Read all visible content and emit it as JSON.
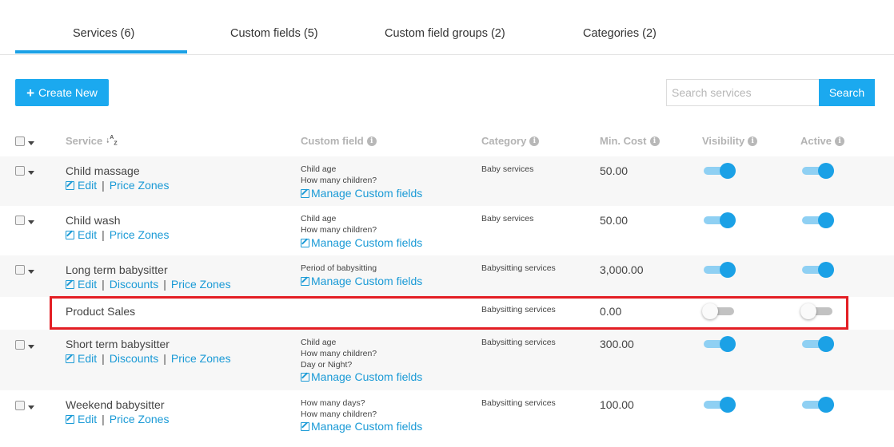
{
  "tabs": [
    {
      "label": "Services (6)"
    },
    {
      "label": "Custom fields (5)"
    },
    {
      "label": "Custom field groups (2)"
    },
    {
      "label": "Categories (2)"
    }
  ],
  "toolbar": {
    "create_label": "Create New",
    "search_placeholder": "Search services",
    "search_label": "Search"
  },
  "columns": {
    "service": "Service",
    "custom_field": "Custom field",
    "category": "Category",
    "min_cost": "Min. Cost",
    "visibility": "Visibility",
    "active": "Active"
  },
  "link_labels": {
    "edit": "Edit",
    "discounts": "Discounts",
    "price_zones": "Price Zones",
    "manage": "Manage Custom fields",
    "separator": "|"
  },
  "rows": [
    {
      "name": "Child massage",
      "custom_fields": [
        "Child age",
        "How many children?"
      ],
      "category": "Baby services",
      "cost": "50.00",
      "visible": true,
      "active": true
    },
    {
      "name": "Child wash",
      "custom_fields": [
        "Child age",
        "How many children?"
      ],
      "category": "Baby services",
      "cost": "50.00",
      "visible": true,
      "active": true
    },
    {
      "name": "Long term babysitter",
      "custom_fields": [
        "Period of babysitting"
      ],
      "category": "Babysitting services",
      "cost": "3,000.00",
      "visible": true,
      "active": true
    },
    {
      "name": "Product Sales",
      "custom_fields": [],
      "category": "Babysitting services",
      "cost": "0.00",
      "visible": false,
      "active": false
    },
    {
      "name": "Short term babysitter",
      "custom_fields": [
        "Child age",
        "How many children?",
        "Day or Night?"
      ],
      "category": "Babysitting services",
      "cost": "300.00",
      "visible": true,
      "active": true
    },
    {
      "name": "Weekend babysitter",
      "custom_fields": [
        "How many days?",
        "How many children?"
      ],
      "category": "Babysitting services",
      "cost": "100.00",
      "visible": true,
      "active": true
    }
  ],
  "colors": {
    "accent": "#1ba9ef",
    "highlight": "#e31e24",
    "link": "#1a9ad6"
  }
}
